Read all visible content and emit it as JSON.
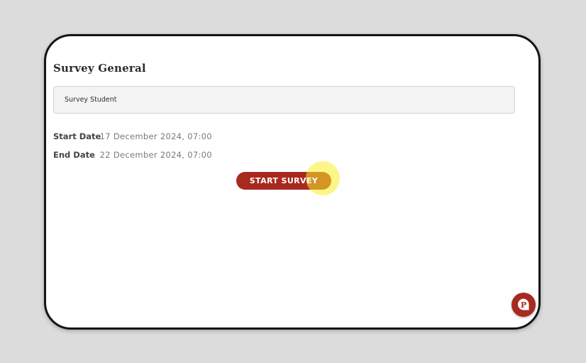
{
  "survey": {
    "title": "Survey General",
    "name": "Survey Student",
    "start_label": "Start Date",
    "start_value": "17 December 2024, 07:00",
    "end_label": "End Date",
    "end_value": "22 December 2024, 07:00",
    "start_button_label": "START SURVEY"
  },
  "help_button": {
    "icon": "chat-p-icon",
    "glyph": "P"
  },
  "colors": {
    "accent": "#a8291f",
    "highlight": "#faee28"
  }
}
